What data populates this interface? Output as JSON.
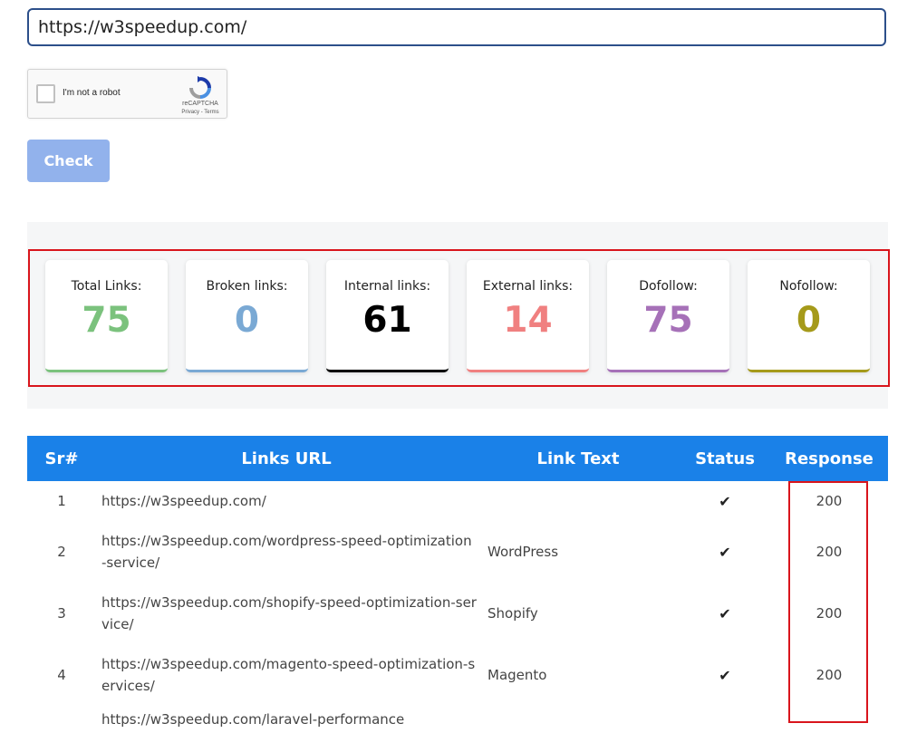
{
  "form": {
    "url_value": "https://w3speedup.com/",
    "captcha": {
      "label": "I'm not a robot",
      "brand": "reCAPTCHA",
      "terms": "Privacy - Terms"
    },
    "check_label": "Check"
  },
  "stats": [
    {
      "label": "Total Links:",
      "value": "75",
      "color": "#7bc27d"
    },
    {
      "label": "Broken links:",
      "value": "0",
      "color": "#7aa9d4"
    },
    {
      "label": "Internal links:",
      "value": "61",
      "color": "#000000"
    },
    {
      "label": "External links:",
      "value": "14",
      "color": "#f08080"
    },
    {
      "label": "Dofollow:",
      "value": "75",
      "color": "#a671b8"
    },
    {
      "label": "Nofollow:",
      "value": "0",
      "color": "#a59a1a"
    }
  ],
  "table": {
    "headers": [
      "Sr#",
      "Links URL",
      "Link Text",
      "Status",
      "Response"
    ],
    "rows": [
      {
        "sr": "1",
        "url": "https://w3speedup.com/",
        "text": "",
        "status": "check-icon",
        "response": "200"
      },
      {
        "sr": "2",
        "url": "https://w3speedup.com/wordpress-speed-optimization-service/",
        "text": "WordPress",
        "status": "check-icon",
        "response": "200"
      },
      {
        "sr": "3",
        "url": "https://w3speedup.com/shopify-speed-optimization-service/",
        "text": "Shopify",
        "status": "check-icon",
        "response": "200"
      },
      {
        "sr": "4",
        "url": "https://w3speedup.com/magento-speed-optimization-services/",
        "text": "Magento",
        "status": "check-icon",
        "response": "200"
      },
      {
        "sr": "",
        "url": "https://w3speedup.com/laravel-performance",
        "text": "",
        "status": "",
        "response": ""
      }
    ]
  },
  "colors": {
    "header_bg": "#1a81e8",
    "highlight": "#d9151c",
    "check_button": "#92b2ec",
    "input_border": "#2c4f8a"
  }
}
